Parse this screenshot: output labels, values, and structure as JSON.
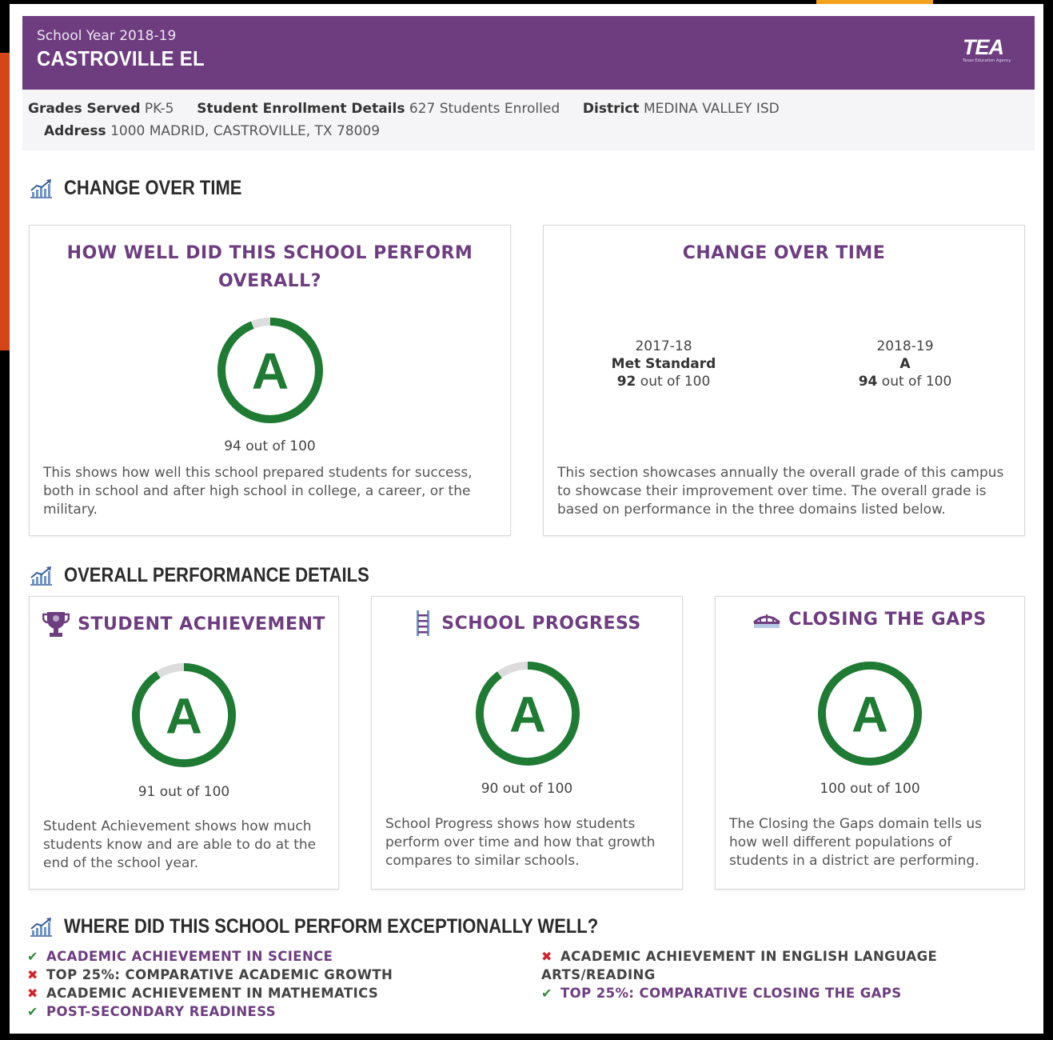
{
  "header": {
    "school_year": "School Year 2018-19",
    "school_name": "CASTROVILLE EL",
    "logo_text": "TEA",
    "logo_subtext": "Texas Education Agency"
  },
  "info": {
    "grades_label": "Grades Served",
    "grades_value": "PK-5",
    "enrollment_label": "Student Enrollment Details",
    "enrollment_value": "627 Students Enrolled",
    "district_label": "District",
    "district_value": "MEDINA VALLEY ISD",
    "address_label": "Address",
    "address_value": "1000 MADRID, CASTROVILLE, TX 78009"
  },
  "sections": {
    "change_over_time": "CHANGE OVER TIME",
    "overall_details": "OVERALL PERFORMANCE DETAILS",
    "distinctions": "WHERE DID THIS SCHOOL PERFORM EXCEPTIONALLY WELL?"
  },
  "overall": {
    "heading_line1": "HOW WELL DID THIS SCHOOL PERFORM",
    "heading_line2": "OVERALL?",
    "grade": "A",
    "score": 94,
    "score_text": "94 out of 100",
    "description": "This shows how well this school prepared students for success, both in school and after high school in college, a career, or the military."
  },
  "change": {
    "heading": "CHANGE OVER TIME",
    "years": [
      {
        "year": "2017-18",
        "rating": "Met Standard",
        "score_num": "92",
        "score_suffix": " out of 100"
      },
      {
        "year": "2018-19",
        "rating": "A",
        "score_num": "94",
        "score_suffix": " out of 100"
      }
    ],
    "description": "This section showcases annually the overall grade of this campus to showcase their improvement over time. The overall grade is based on performance in the three domains listed below."
  },
  "domains": [
    {
      "title": "STUDENT ACHIEVEMENT",
      "icon": "trophy-icon",
      "grade": "A",
      "score": 91,
      "score_text": "91 out of 100",
      "description": "Student Achievement shows how much students know and are able to do at the end of the school year."
    },
    {
      "title": "SCHOOL PROGRESS",
      "icon": "ladder-icon",
      "grade": "A",
      "score": 90,
      "score_text": "90 out of 100",
      "description": "School Progress shows how students perform over time and how that growth compares to similar schools."
    },
    {
      "title": "CLOSING THE GAPS",
      "icon": "bridge-icon",
      "grade": "A",
      "score": 100,
      "score_text": "100 out of 100",
      "description": "The Closing the Gaps domain tells us how well different populations of students in a district are performing."
    }
  ],
  "distinctions": {
    "left": [
      {
        "label": "ACADEMIC ACHIEVEMENT IN SCIENCE",
        "earned": true
      },
      {
        "label": "TOP 25%: COMPARATIVE ACADEMIC GROWTH",
        "earned": false
      },
      {
        "label": "ACADEMIC ACHIEVEMENT IN MATHEMATICS",
        "earned": false
      },
      {
        "label": "POST-SECONDARY READINESS",
        "earned": true
      }
    ],
    "right": [
      {
        "label_line1": "ACADEMIC ACHIEVEMENT IN ENGLISH LANGUAGE",
        "label_line2": "ARTS/READING",
        "earned": false
      },
      {
        "label": "TOP 25%: COMPARATIVE CLOSING THE GAPS",
        "earned": true
      }
    ]
  },
  "colors": {
    "header_purple": "#6d3d80",
    "ring_green": "#1f7a33",
    "ring_gray": "#dcdcdc",
    "check_green": "#2e8b3e",
    "cross_red": "#d2232a",
    "accent_orange": "#d4461a"
  }
}
